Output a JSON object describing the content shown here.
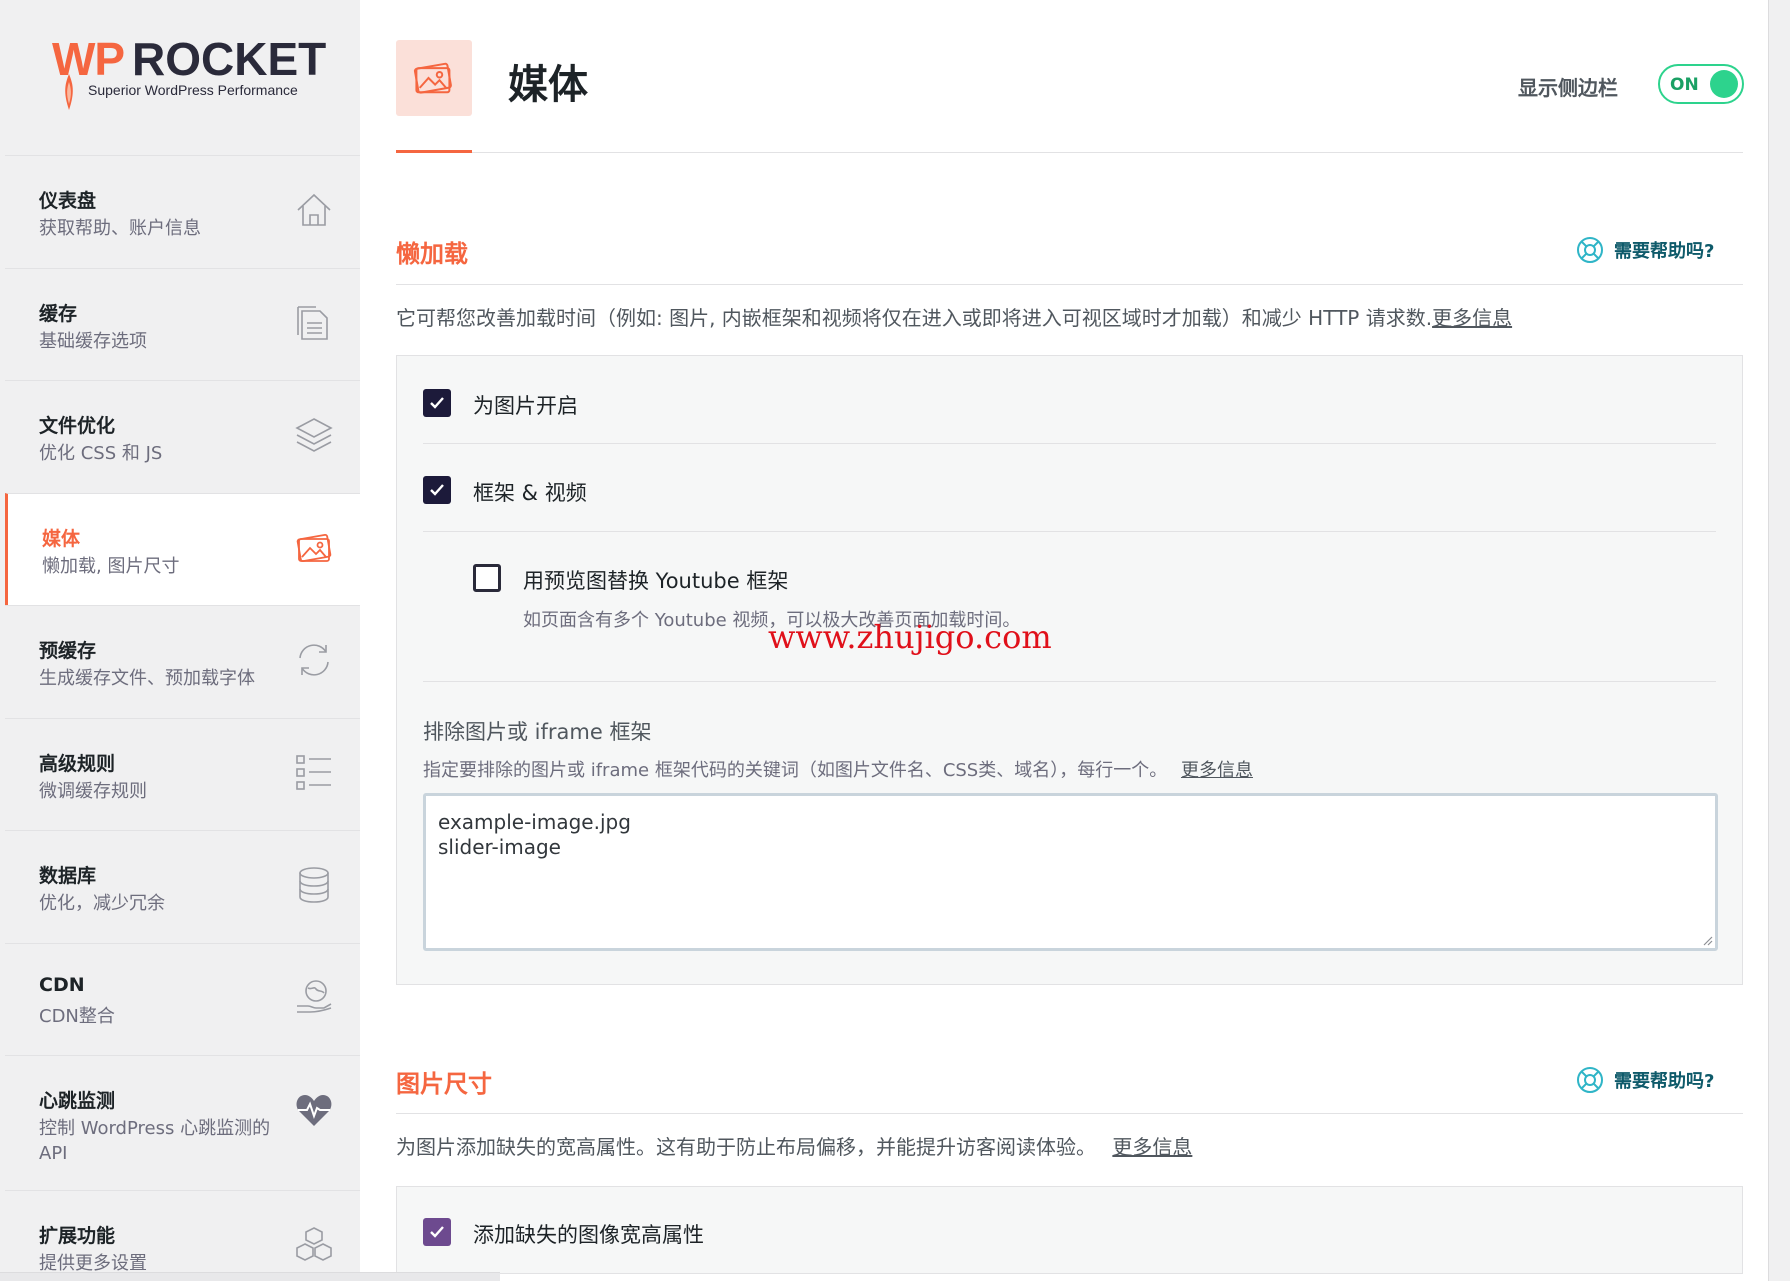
{
  "brand": {
    "logo_wp": "WP",
    "logo_rocket": "ROCKET",
    "tagline": "Superior WordPress Performance",
    "accent_color": "#f56640"
  },
  "sidebar": {
    "items": [
      {
        "title": "仪表盘",
        "subtitle": "获取帮助、账户信息",
        "icon": "home-icon"
      },
      {
        "title": "缓存",
        "subtitle": "基础缓存选项",
        "icon": "file-icon"
      },
      {
        "title": "文件优化",
        "subtitle": "优化 CSS 和 JS",
        "icon": "layers-icon"
      },
      {
        "title": "媒体",
        "subtitle": "懒加载, 图片尺寸",
        "icon": "images-icon",
        "active": true
      },
      {
        "title": "预缓存",
        "subtitle": "生成缓存文件、预加载字体",
        "icon": "refresh-icon"
      },
      {
        "title": "高级规则",
        "subtitle": "微调缓存规则",
        "icon": "list-icon"
      },
      {
        "title": "数据库",
        "subtitle": "优化，减少冗余",
        "icon": "database-icon"
      },
      {
        "title": "CDN",
        "subtitle": "CDN整合",
        "icon": "globe-hand-icon"
      },
      {
        "title": "心跳监测",
        "subtitle": "控制 WordPress 心跳监测的 API",
        "icon": "heartbeat-icon"
      },
      {
        "title": "扩展功能",
        "subtitle": "提供更多设置",
        "icon": "boxes-icon"
      }
    ]
  },
  "header": {
    "title": "媒体",
    "sidebar_toggle_label": "显示侧边栏",
    "toggle_state": "ON"
  },
  "lazyload": {
    "title": "懒加载",
    "help": "需要帮助吗?",
    "description": "它可帮您改善加载时间（例如: 图片, 内嵌框架和视频将仅在进入或即将进入可视区域时才加载）和减少 HTTP 请求数.",
    "more_info": "更多信息",
    "option_images": "为图片开启",
    "option_iframes": "框架 & 视频",
    "option_youtube": "用预览图替换 Youtube 框架",
    "option_youtube_desc": "如页面含有多个 Youtube 视频，可以极大改善页面加载时间。",
    "exclude_title": "排除图片或 iframe 框架",
    "exclude_desc": "指定要排除的图片或 iframe 框架代码的关键词（如图片文件名、CSS类、域名），每行一个。",
    "exclude_more": "更多信息",
    "exclude_line1": "example-image.jpg",
    "exclude_line2": "slider-image",
    "images_checked": true,
    "iframes_checked": true,
    "youtube_checked": false
  },
  "image_dimensions": {
    "title": "图片尺寸",
    "help": "需要帮助吗?",
    "description": "为图片添加缺失的宽高属性。这有助于防止布局偏移，并能提升访客阅读体验。",
    "more_info": "更多信息",
    "option_add": "添加缺失的图像宽高属性",
    "add_checked": true
  },
  "watermark": "www.zhujigo.com"
}
